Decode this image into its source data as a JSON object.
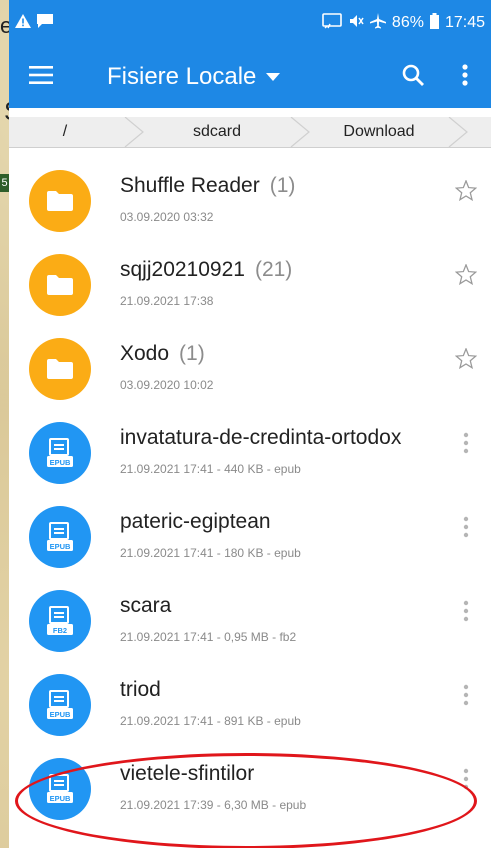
{
  "background_fragments": {
    "e": "e",
    "s": "S",
    "five": "5"
  },
  "status_bar": {
    "battery_percent": "86%",
    "time": "17:45"
  },
  "toolbar": {
    "title": "Fisiere Locale",
    "menu_icon": "hamburger-menu-icon",
    "search_icon": "search-icon",
    "overflow_icon": "more-vertical-icon"
  },
  "breadcrumb": [
    "/",
    "sdcard",
    "Download"
  ],
  "files": [
    {
      "type": "folder",
      "name": "Shuffle Reader",
      "count": "(1)",
      "meta": "03.09.2020 03:32",
      "action": "star-outline-icon"
    },
    {
      "type": "folder",
      "name": "sqjj20210921",
      "count": "(21)",
      "meta": "21.09.2021 17:38",
      "action": "star-outline-icon"
    },
    {
      "type": "folder",
      "name": "Xodo",
      "count": "(1)",
      "meta": "03.09.2020 10:02",
      "action": "star-outline-icon"
    },
    {
      "type": "book",
      "badge": "EPUB",
      "name": "invatatura-de-credinta-ortodox",
      "meta": "21.09.2021 17:41 - 440 KB - epub",
      "action": "more-vertical-icon"
    },
    {
      "type": "book",
      "badge": "EPUB",
      "name": "pateric-egiptean",
      "meta": "21.09.2021 17:41 - 180 KB - epub",
      "action": "more-vertical-icon"
    },
    {
      "type": "book",
      "badge": "FB2",
      "name": "scara",
      "meta": "21.09.2021 17:41 - 0,95 MB - fb2",
      "action": "more-vertical-icon"
    },
    {
      "type": "book",
      "badge": "EPUB",
      "name": "triod",
      "meta": "21.09.2021 17:41 - 891 KB - epub",
      "action": "more-vertical-icon"
    },
    {
      "type": "book",
      "badge": "EPUB",
      "name": "vietele-sfintilor",
      "meta": "21.09.2021 17:39 - 6,30 MB - epub",
      "action": "more-vertical-icon"
    }
  ],
  "colors": {
    "primary": "#1e88e5",
    "folder": "#fbac15",
    "book": "#2196f3",
    "highlight": "#e0161b"
  }
}
